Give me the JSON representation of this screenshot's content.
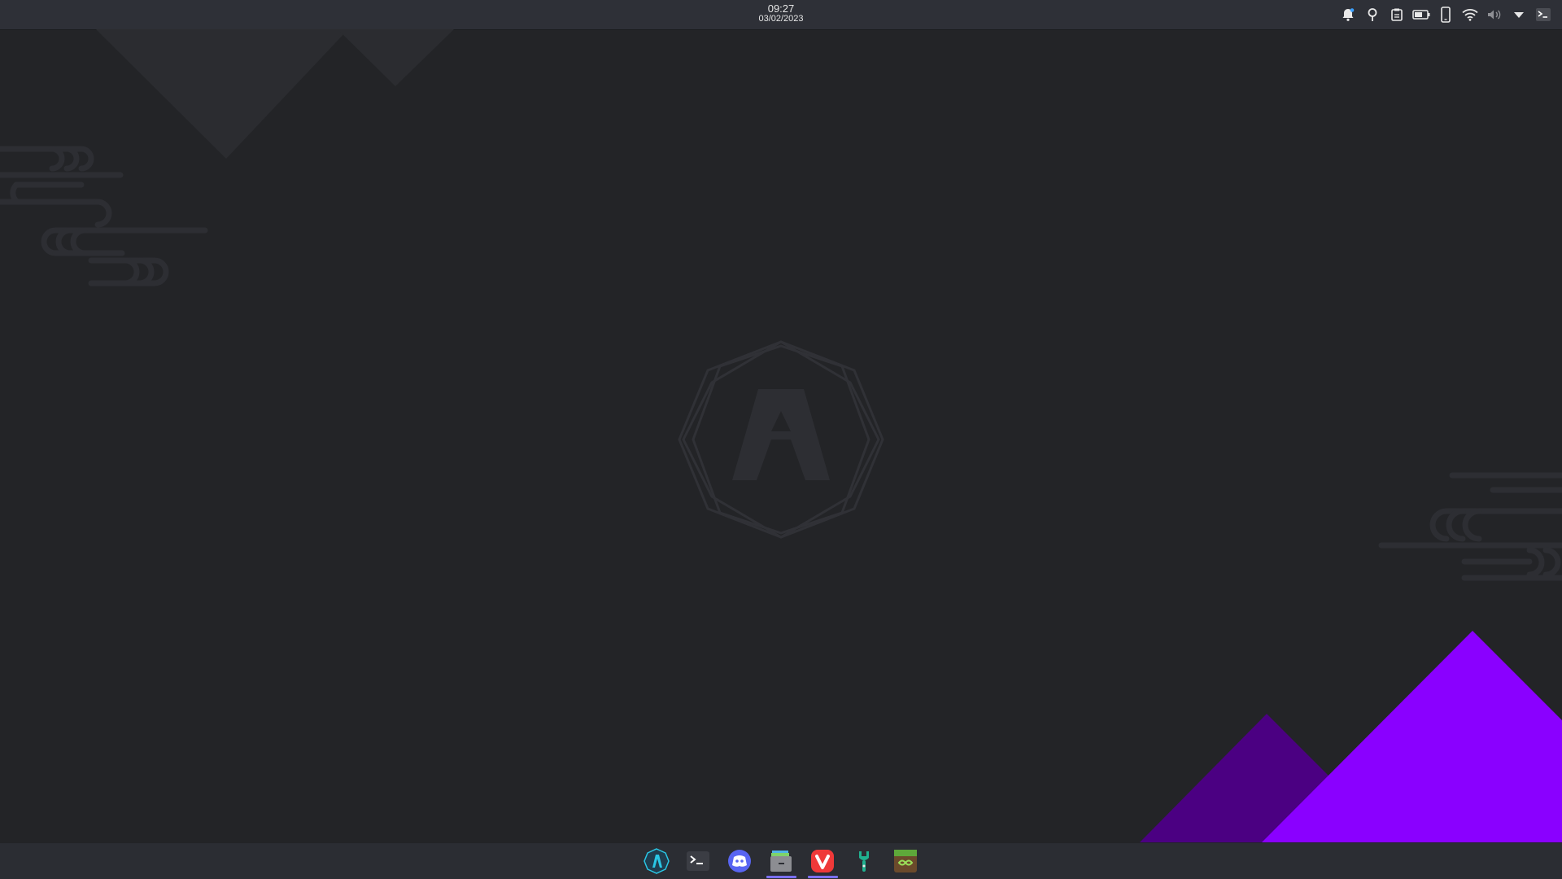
{
  "topbar": {
    "time": "09:27",
    "date": "03/02/2023",
    "tray_icons": [
      "notifications-icon",
      "location-icon",
      "clipboard-icon",
      "battery-icon",
      "phone-icon",
      "wifi-icon",
      "volume-icon",
      "tray-expand-icon",
      "terminal-icon"
    ]
  },
  "wallpaper": {
    "logo": "archcraft-logo",
    "accent_colors": [
      "#8a00ff",
      "#4b0082"
    ]
  },
  "dock": {
    "apps": [
      {
        "name": "archcraft-launcher",
        "icon": "archcraft-icon",
        "running": false
      },
      {
        "name": "terminal",
        "icon": "terminal-icon",
        "running": false
      },
      {
        "name": "discord",
        "icon": "discord-icon",
        "running": false
      },
      {
        "name": "file-manager",
        "icon": "file-manager-icon",
        "running": true
      },
      {
        "name": "vivaldi",
        "icon": "vivaldi-icon",
        "running": true
      },
      {
        "name": "settings",
        "icon": "settings-wrench-icon",
        "running": false
      },
      {
        "name": "minecraft-launcher",
        "icon": "minecraft-icon",
        "running": false
      }
    ]
  }
}
